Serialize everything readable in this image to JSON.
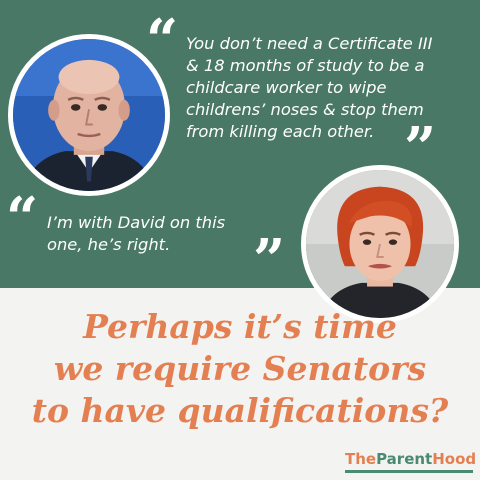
{
  "quotes": [
    {
      "lines": [
        "You don’t need a Certificate III",
        "& 18 months of study to be a",
        "childcare worker to wipe",
        "childrens’ noses & stop them",
        "from killing each other."
      ]
    },
    {
      "lines": [
        "I’m with David on this",
        "one, he’s right."
      ]
    }
  ],
  "quote_marks": {
    "open": "“",
    "close": "”"
  },
  "headline": {
    "lines": [
      "Perhaps it’s time",
      "we require Senators",
      "to have qualifications?"
    ]
  },
  "brand": {
    "part1": "The",
    "part2": "Parent",
    "part3": "Hood"
  },
  "colors": {
    "panel_green": "#4a7866",
    "background": "#f3f3f1",
    "headline_orange": "#e47f52",
    "brand_green": "#4a8a72",
    "quote_text": "#ffffff"
  }
}
